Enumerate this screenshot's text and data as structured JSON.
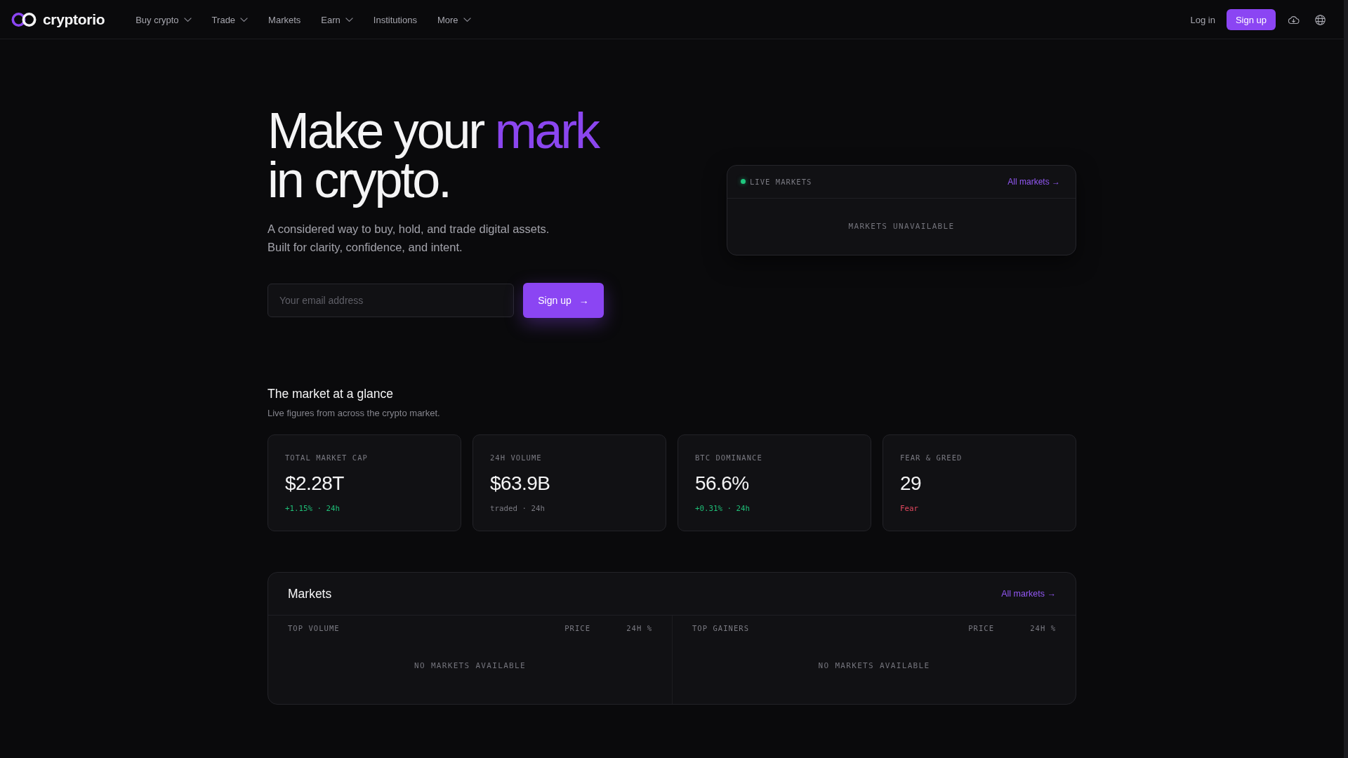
{
  "nav": {
    "brand": "cryptorio",
    "items": [
      {
        "label": "Buy crypto",
        "has_menu": true
      },
      {
        "label": "Trade",
        "has_menu": true
      },
      {
        "label": "Markets",
        "has_menu": false
      },
      {
        "label": "Earn",
        "has_menu": true
      },
      {
        "label": "Institutions",
        "has_menu": false
      },
      {
        "label": "More",
        "has_menu": true
      }
    ],
    "login": "Log in",
    "signup": "Sign up"
  },
  "hero": {
    "headline": {
      "lead": "Make your",
      "accent": "mark",
      "tail": "in crypto."
    },
    "subtitle": [
      "A considered way to buy, hold, and trade digital assets.",
      "Built for clarity, confidence, and intent."
    ],
    "email": {
      "placeholder": "Your email address"
    },
    "cta": {
      "label": "Sign up",
      "arrow": "→"
    }
  },
  "live_markets": {
    "title": "LIVE MARKETS",
    "live": true,
    "link": "All markets →",
    "message": "MARKETS UNAVAILABLE"
  },
  "glance": {
    "title": "The market at a glance",
    "subtitle": "Live figures from across the crypto market.",
    "stats": [
      {
        "label": "TOTAL MARKET CAP",
        "value": "$2.28T",
        "note": "+1.15% · 24h",
        "color": "#1fbf77"
      },
      {
        "label": "24H VOLUME",
        "value": "$63.9B",
        "note": "traded · 24h",
        "color": "#7b7b83"
      },
      {
        "label": "BTC DOMINANCE",
        "value": "56.6%",
        "note": "+0.31% · 24h",
        "color": "#1fbf77"
      },
      {
        "label": "FEAR & GREED",
        "value": "29",
        "note": "Fear",
        "color": "#e3485f"
      }
    ]
  },
  "markets": {
    "title": "Markets",
    "link": "All markets →",
    "tables": [
      {
        "columns": [
          "TOP VOLUME",
          "PRICE",
          "24H %"
        ],
        "message": "NO MARKETS AVAILABLE"
      },
      {
        "columns": [
          "TOP GAINERS",
          "PRICE",
          "24H %"
        ],
        "message": "NO MARKETS AVAILABLE"
      }
    ]
  }
}
